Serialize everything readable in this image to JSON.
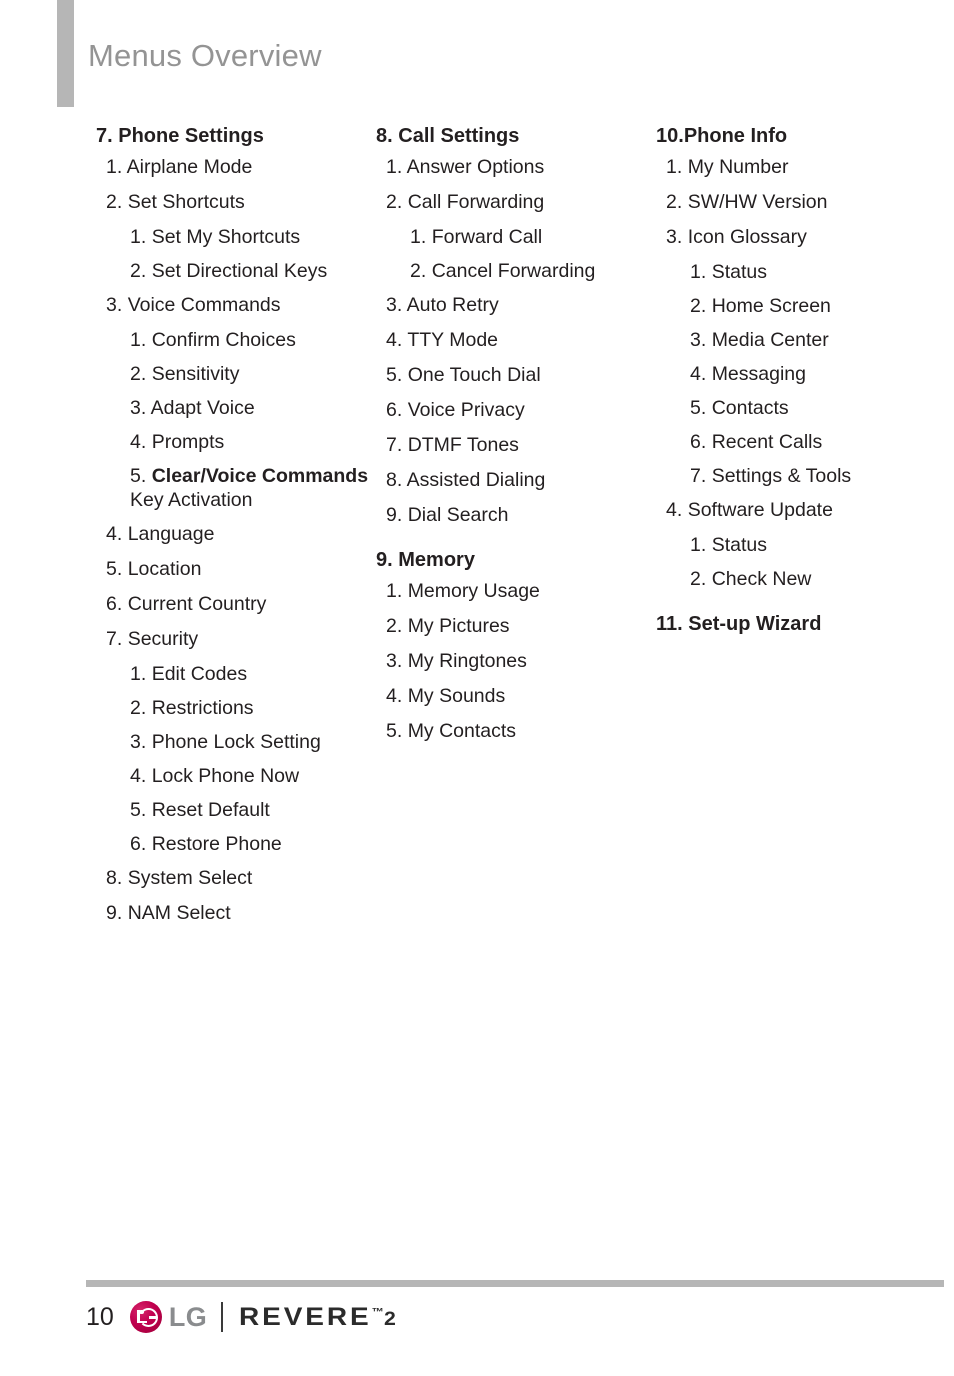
{
  "header": {
    "title": "Menus Overview"
  },
  "columns": [
    {
      "id": "column-1",
      "entries": [
        {
          "level": 0,
          "num": "7.",
          "text": "Phone Settings"
        },
        {
          "level": 1,
          "num": "1.",
          "text": "Airplane Mode"
        },
        {
          "level": 1,
          "num": "2.",
          "text": "Set Shortcuts"
        },
        {
          "level": 2,
          "num": "1.",
          "text": "Set My Shortcuts"
        },
        {
          "level": 2,
          "num": "2.",
          "text": "Set Directional Keys"
        },
        {
          "level": 1,
          "num": "3.",
          "text": "Voice Commands"
        },
        {
          "level": 2,
          "num": "1.",
          "text": "Confirm Choices"
        },
        {
          "level": 2,
          "num": "2.",
          "text": "Sensitivity"
        },
        {
          "level": 2,
          "num": "3.",
          "text": "Adapt Voice"
        },
        {
          "level": 2,
          "num": "4.",
          "text": "Prompts"
        },
        {
          "level": 2,
          "num": "5.",
          "text": "Clear/Voice Commands Key Activation",
          "bold_prefix": "Clear/Voice Commands",
          "bold_suffix": " Key Activation"
        },
        {
          "level": 1,
          "num": "4.",
          "text": "Language"
        },
        {
          "level": 1,
          "num": "5.",
          "text": "Location"
        },
        {
          "level": 1,
          "num": "6.",
          "text": "Current Country"
        },
        {
          "level": 1,
          "num": "7.",
          "text": "Security"
        },
        {
          "level": 2,
          "num": "1.",
          "text": "Edit Codes"
        },
        {
          "level": 2,
          "num": "2.",
          "text": "Restrictions"
        },
        {
          "level": 2,
          "num": "3.",
          "text": "Phone Lock Setting"
        },
        {
          "level": 2,
          "num": "4.",
          "text": "Lock Phone Now"
        },
        {
          "level": 2,
          "num": "5.",
          "text": "Reset Default"
        },
        {
          "level": 2,
          "num": "6.",
          "text": "Restore Phone"
        },
        {
          "level": 1,
          "num": "8.",
          "text": "System Select"
        },
        {
          "level": 1,
          "num": "9.",
          "text": "NAM Select"
        }
      ]
    },
    {
      "id": "column-2",
      "entries": [
        {
          "level": 0,
          "num": "8.",
          "text": "Call Settings"
        },
        {
          "level": 1,
          "num": "1.",
          "text": "Answer Options"
        },
        {
          "level": 1,
          "num": "2.",
          "text": "Call Forwarding"
        },
        {
          "level": 2,
          "num": "1.",
          "text": "Forward Call"
        },
        {
          "level": 2,
          "num": "2.",
          "text": "Cancel Forwarding"
        },
        {
          "level": 1,
          "num": "3.",
          "text": "Auto Retry"
        },
        {
          "level": 1,
          "num": "4.",
          "text": "TTY Mode"
        },
        {
          "level": 1,
          "num": "5.",
          "text": "One Touch Dial"
        },
        {
          "level": 1,
          "num": "6.",
          "text": "Voice Privacy"
        },
        {
          "level": 1,
          "num": "7.",
          "text": "DTMF Tones"
        },
        {
          "level": 1,
          "num": "8.",
          "text": "Assisted Dialing"
        },
        {
          "level": 1,
          "num": "9.",
          "text": "Dial Search"
        },
        {
          "level": 0,
          "num": "9.",
          "text": "Memory",
          "gap_before": true
        },
        {
          "level": 1,
          "num": "1.",
          "text": "Memory Usage"
        },
        {
          "level": 1,
          "num": "2.",
          "text": "My Pictures"
        },
        {
          "level": 1,
          "num": "3.",
          "text": "My Ringtones"
        },
        {
          "level": 1,
          "num": "4.",
          "text": "My Sounds"
        },
        {
          "level": 1,
          "num": "5.",
          "text": "My Contacts"
        }
      ]
    },
    {
      "id": "column-3",
      "entries": [
        {
          "level": 0,
          "num": "10.",
          "text": "Phone Info",
          "tight": true
        },
        {
          "level": 1,
          "num": "1.",
          "text": "My Number"
        },
        {
          "level": 1,
          "num": "2.",
          "text": "SW/HW Version"
        },
        {
          "level": 1,
          "num": "3.",
          "text": "Icon Glossary"
        },
        {
          "level": 2,
          "num": "1.",
          "text": "Status"
        },
        {
          "level": 2,
          "num": "2.",
          "text": "Home Screen"
        },
        {
          "level": 2,
          "num": "3.",
          "text": "Media Center"
        },
        {
          "level": 2,
          "num": "4.",
          "text": "Messaging"
        },
        {
          "level": 2,
          "num": "5.",
          "text": "Contacts"
        },
        {
          "level": 2,
          "num": "6.",
          "text": "Recent Calls"
        },
        {
          "level": 2,
          "num": "7.",
          "text": "Settings & Tools"
        },
        {
          "level": 1,
          "num": "4.",
          "text": "Software Update"
        },
        {
          "level": 2,
          "num": "1.",
          "text": "Status"
        },
        {
          "level": 2,
          "num": "2.",
          "text": "Check New"
        },
        {
          "level": 0,
          "num": "11.",
          "text": "Set-up Wizard",
          "gap_before": true
        }
      ]
    }
  ],
  "footer": {
    "page_number": "10",
    "lg_wordmark": "LG",
    "product_name": "REVERE",
    "product_tm": "™",
    "product_version": "2"
  },
  "colors": {
    "title_gray": "#949494",
    "rule_gray": "#b6b6b6",
    "body_black": "#231f20",
    "lg_crimson": "#a50034",
    "lg_wordmark_gray": "#8a8c8e"
  }
}
